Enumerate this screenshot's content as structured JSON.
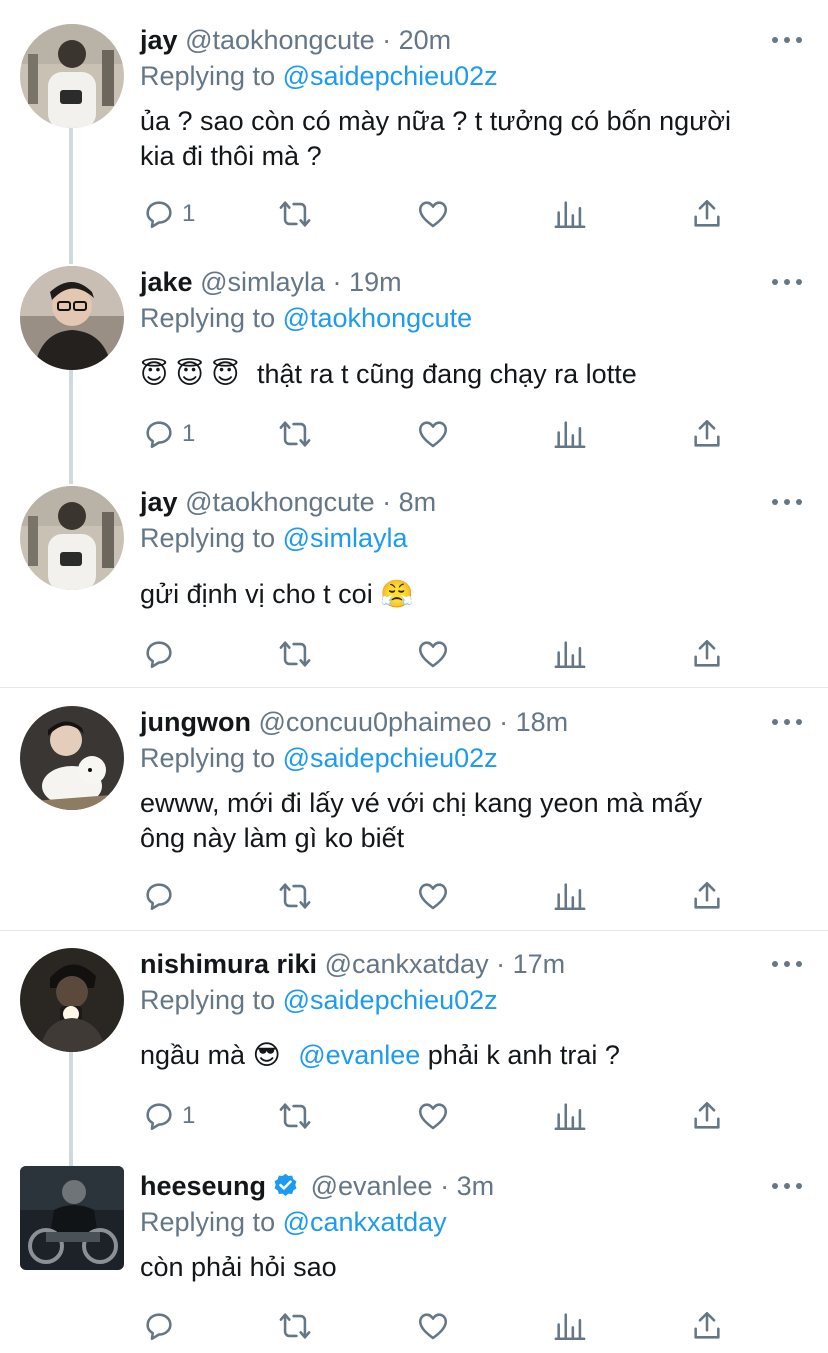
{
  "tweets": [
    {
      "name": "jay",
      "handle": "@taokhongcute",
      "dot": "·",
      "time": "20m",
      "replying_prefix": "Replying to",
      "replying_to": "@saidepchieu02z",
      "text_line1": "ủa ? sao còn có mày nữa ? t tưởng có bốn người",
      "text_line2": "kia đi thôi mà ?",
      "reply_count": "1"
    },
    {
      "name": "jake",
      "handle": "@simlayla",
      "dot": "·",
      "time": "19m",
      "replying_prefix": "Replying to",
      "replying_to": "@taokhongcute",
      "emoji_prefix": "😇 😇 😇",
      "text": "thật ra t cũng đang chạy ra lotte",
      "reply_count": "1"
    },
    {
      "name": "jay",
      "handle": "@taokhongcute",
      "dot": "·",
      "time": "8m",
      "replying_prefix": "Replying to",
      "replying_to": "@simlayla",
      "text": "gửi định vị cho t coi",
      "emoji_suffix": "😤"
    },
    {
      "name": "jungwon",
      "handle": "@concuu0phaimeo",
      "dot": "·",
      "time": "18m",
      "replying_prefix": "Replying to",
      "replying_to": "@saidepchieu02z",
      "text_line1": "ewww, mới đi lấy vé với chị kang yeon mà mấy",
      "text_line2": "ông này làm gì ko biết"
    },
    {
      "name": "nishimura riki",
      "handle": "@cankxatday",
      "dot": "·",
      "time": "17m",
      "replying_prefix": "Replying to",
      "replying_to": "@saidepchieu02z",
      "text_before": "ngầu mà",
      "emoji": "😎",
      "mention": "@evanlee",
      "text_after": "phải k anh trai ?",
      "reply_count": "1"
    },
    {
      "name": "heeseung",
      "verified": true,
      "handle": "@evanlee",
      "dot": "·",
      "time": "3m",
      "replying_prefix": "Replying to",
      "replying_to": "@cankxatday",
      "text": "còn phải hỏi sao"
    }
  ],
  "icons": [
    "reply-icon",
    "retweet-icon",
    "like-icon",
    "analytics-icon",
    "share-icon",
    "more-icon",
    "verified-icon"
  ],
  "colors": {
    "accent": "#1d9bf0",
    "secondary_text": "#657786",
    "thread_line": "#cfd9de",
    "divider": "#e1e8ed"
  }
}
